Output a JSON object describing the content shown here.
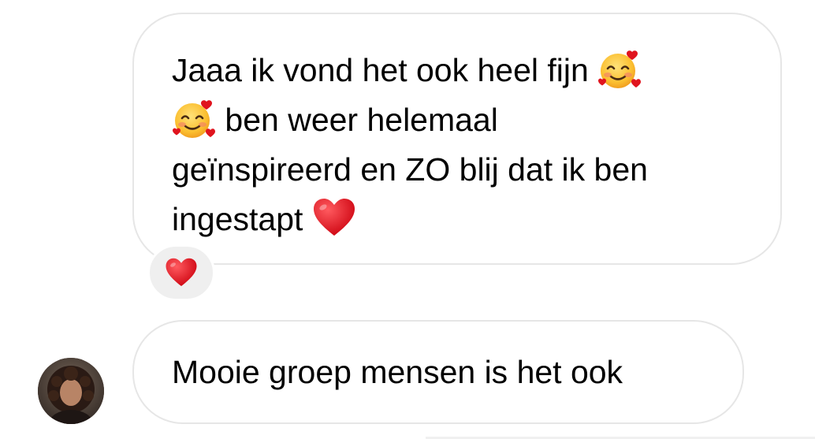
{
  "messages": [
    {
      "id": "msg-1",
      "lines": [
        {
          "text": "Jaaa ik vond het ook heel fijn",
          "emoji_after": "smiling-face-with-hearts"
        },
        {
          "emoji_before": "smiling-face-with-hearts",
          "text": "ben weer helemaal"
        },
        {
          "text": "geïnspireerd en ZO blij dat ik ben"
        },
        {
          "text": "ingestapt",
          "emoji_after": "red-heart"
        }
      ],
      "reaction": "red-heart"
    },
    {
      "id": "msg-2",
      "text": "Mooie groep mensen is het ook",
      "avatar": "sender-avatar"
    }
  ],
  "colors": {
    "bubble_border": "#e6e6e6",
    "reaction_bg": "#efefef",
    "text": "#000000",
    "heart": "#e0141e"
  }
}
